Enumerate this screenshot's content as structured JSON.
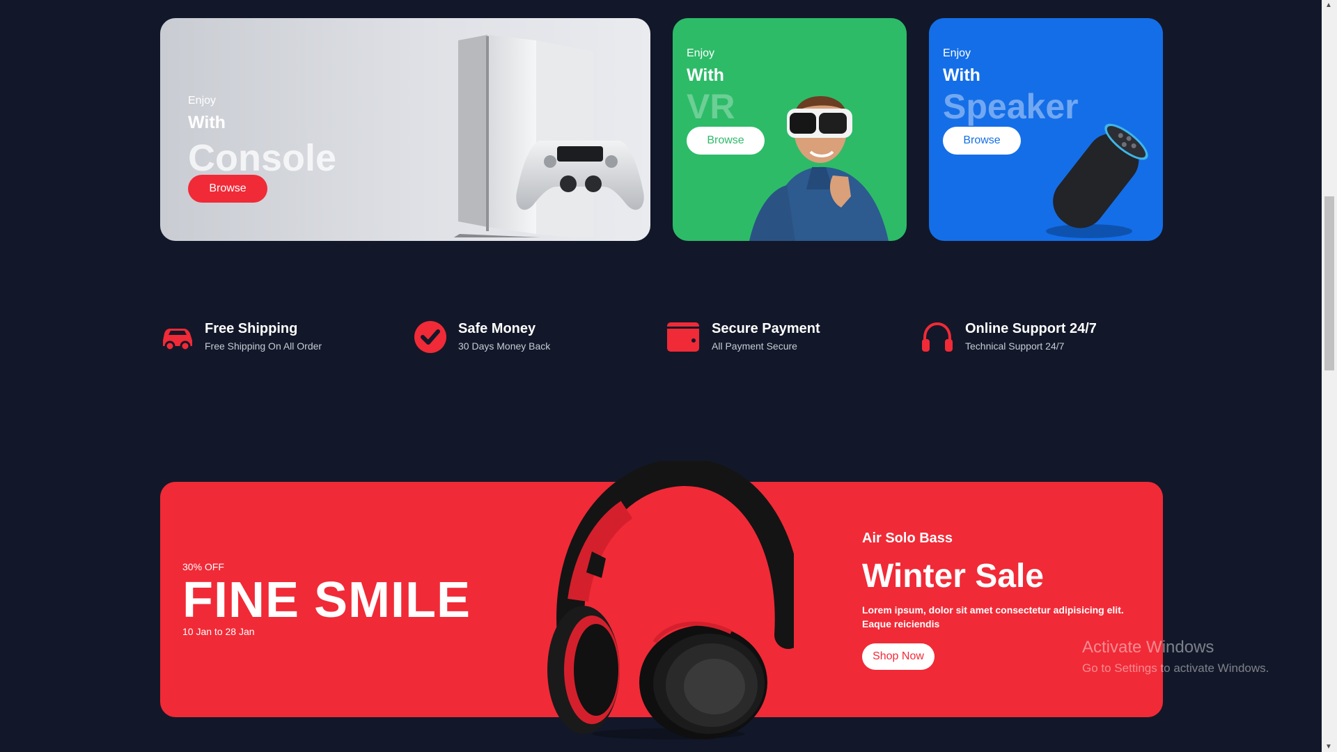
{
  "cards": [
    {
      "small": "Enjoy",
      "mid": "With",
      "big": "Console",
      "button": "Browse"
    },
    {
      "small": "Enjoy",
      "mid": "With",
      "big": "VR",
      "button": "Browse"
    },
    {
      "small": "Enjoy",
      "mid": "With",
      "big": "Speaker",
      "button": "Browse"
    }
  ],
  "features": [
    {
      "title": "Free Shipping",
      "subtitle": "Free Shipping On All Order",
      "icon": "car-icon"
    },
    {
      "title": "Safe Money",
      "subtitle": "30 Days Money Back",
      "icon": "check-circle-icon"
    },
    {
      "title": "Secure Payment",
      "subtitle": "All Payment Secure",
      "icon": "wallet-icon"
    },
    {
      "title": "Online Support 24/7",
      "subtitle": "Technical Support 24/7",
      "icon": "headphones-icon"
    }
  ],
  "banner": {
    "discount": "30% OFF",
    "headline": "FINE SMILE",
    "dates": "10 Jan to 28 Jan",
    "product": "Air Solo Bass",
    "sale_title": "Winter Sale",
    "description_line1": "Lorem ipsum, dolor sit amet consectetur adipisicing elit.",
    "description_line2": "Eaque reiciendis",
    "button": "Shop Now"
  },
  "watermark": {
    "title": "Activate Windows",
    "subtitle": "Go to Settings to activate Windows."
  },
  "colors": {
    "background": "#121829",
    "accent_red": "#f12a37",
    "vr_green": "#2dbb68",
    "speaker_blue": "#146ee8"
  }
}
